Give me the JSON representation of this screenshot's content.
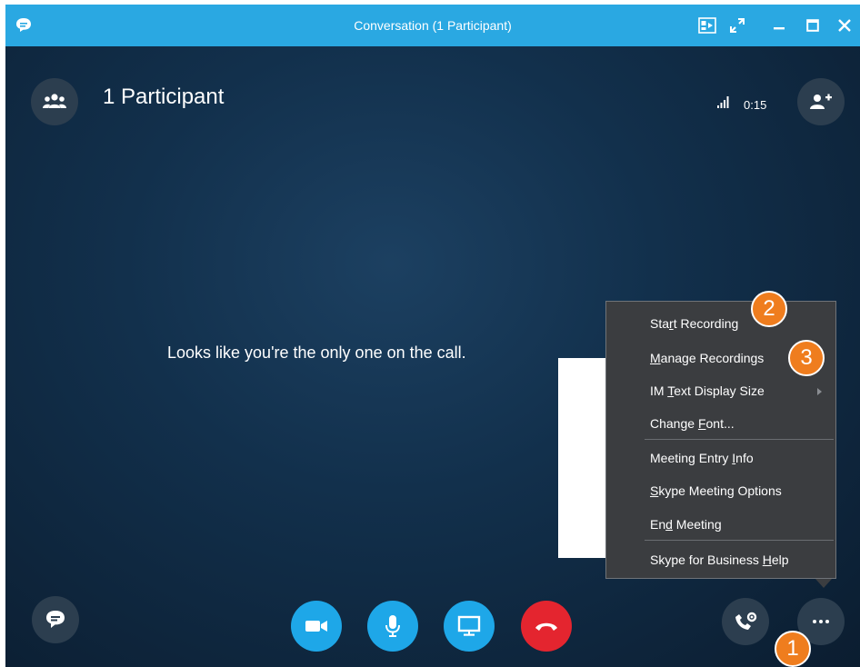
{
  "window": {
    "title": "Conversation (1 Participant)"
  },
  "header": {
    "participants_label": "1 Participant",
    "timer": "0:15"
  },
  "main": {
    "message": "Looks like you're the only one on the call."
  },
  "menu": {
    "items": [
      {
        "pre": "Sta",
        "key": "r",
        "post": "t Recording"
      },
      {
        "pre": "",
        "key": "M",
        "post": "anage Recordings"
      },
      {
        "pre": "IM ",
        "key": "T",
        "post": "ext Display Size"
      },
      {
        "pre": "Change ",
        "key": "F",
        "post": "ont..."
      },
      {
        "pre": "Meeting Entry ",
        "key": "I",
        "post": "nfo"
      },
      {
        "pre": "",
        "key": "S",
        "post": "kype Meeting Options"
      },
      {
        "pre": "En",
        "key": "d",
        "post": " Meeting"
      },
      {
        "pre": "Skype for Business ",
        "key": "H",
        "post": "elp"
      }
    ]
  },
  "callouts": {
    "one": "1",
    "two": "2",
    "three": "3"
  },
  "colors": {
    "titlebar": "#2aa8e2",
    "call_button_blue": "#1ea7e8",
    "hangup_red": "#e4252f",
    "callout_orange": "#ef7d1e"
  }
}
